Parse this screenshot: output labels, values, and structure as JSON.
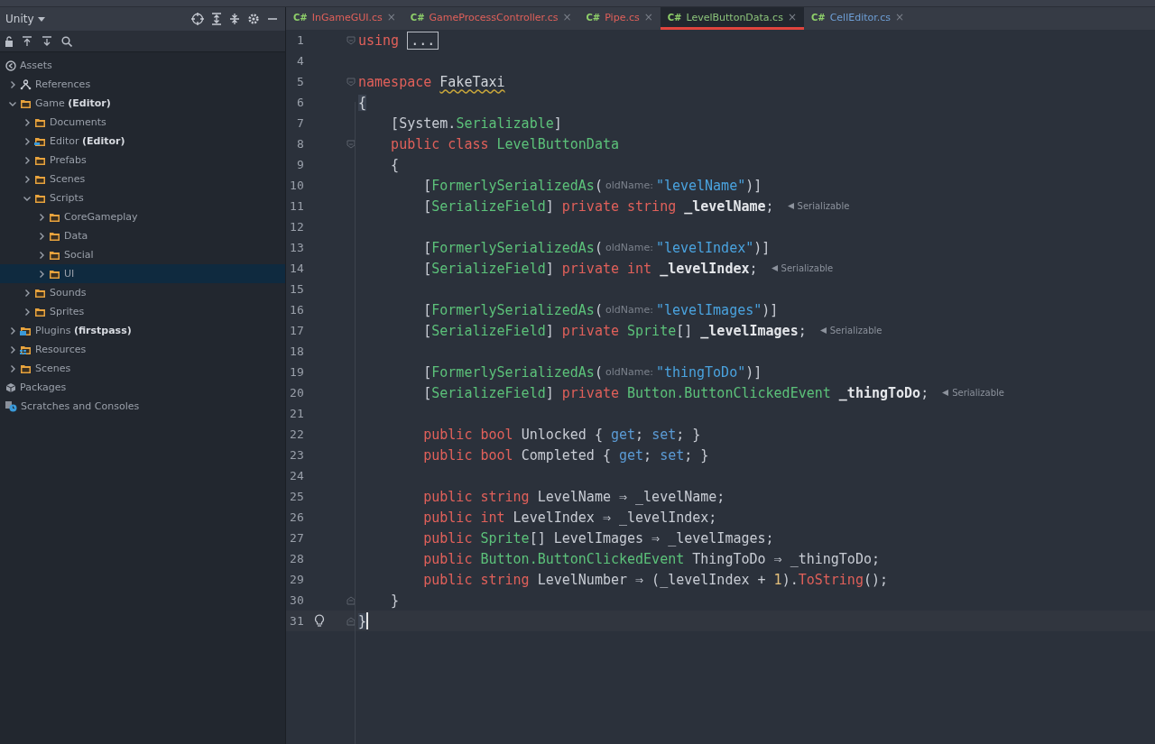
{
  "project": {
    "title": "Unity",
    "tree": [
      {
        "label": "Assets",
        "kind": "assets"
      },
      {
        "label": "References",
        "kind": "references",
        "expanded": false
      },
      {
        "label": "Game **(Editor)**",
        "kind": "folder",
        "expanded": true,
        "selected": false,
        "children": [
          {
            "label": "Documents",
            "kind": "folder",
            "expanded": false,
            "selected": false
          },
          {
            "label": "Editor **(Editor)**",
            "kind": "editor",
            "expanded": false,
            "selected": false
          },
          {
            "label": "Prefabs",
            "kind": "folder",
            "expanded": false,
            "selected": false
          },
          {
            "label": "Scenes",
            "kind": "folder",
            "expanded": false,
            "selected": false
          },
          {
            "label": "Scripts",
            "kind": "folder",
            "expanded": true,
            "selected": false,
            "children": [
              {
                "label": "CoreGameplay",
                "kind": "folder",
                "expanded": false,
                "selected": false
              },
              {
                "label": "Data",
                "kind": "folder",
                "expanded": false,
                "selected": false
              },
              {
                "label": "Social",
                "kind": "folder",
                "expanded": false,
                "selected": false
              },
              {
                "label": "UI",
                "kind": "folder",
                "expanded": false,
                "selected": true
              }
            ]
          },
          {
            "label": "Sounds",
            "kind": "folder",
            "expanded": false,
            "selected": false
          },
          {
            "label": "Sprites",
            "kind": "folder",
            "expanded": false,
            "selected": false
          }
        ]
      },
      {
        "label": "Plugins **(firstpass)**",
        "kind": "plugins",
        "expanded": false,
        "selected": false
      },
      {
        "label": "Resources",
        "kind": "resources",
        "expanded": false,
        "selected": false
      },
      {
        "label": "Scenes",
        "kind": "folder",
        "expanded": false,
        "selected": false
      },
      {
        "label": "Packages",
        "kind": "packages"
      },
      {
        "label": "Scratches and Consoles",
        "kind": "scratches"
      }
    ]
  },
  "tabs": [
    {
      "badge": "C#",
      "label": "InGameGUI.cs",
      "close": "×",
      "color": "#e0605a",
      "selected": false
    },
    {
      "badge": "C#",
      "label": "GameProcessController.cs",
      "close": "×",
      "color": "#e0605a",
      "selected": false
    },
    {
      "badge": "C#",
      "label": "Pipe.cs",
      "close": "×",
      "color": "#e0605a",
      "selected": false
    },
    {
      "badge": "C#",
      "label": "LevelButtonData.cs",
      "close": "×",
      "color": "#8cc47a",
      "selected": true
    },
    {
      "badge": "C#",
      "label": "CellEditor.cs",
      "close": "×",
      "color": "#6e9fd6",
      "selected": false
    }
  ],
  "code": [
    {
      "n": "1",
      "fold_open": true,
      "tokens": [
        {
          "text": "using ",
          "kind": "kw"
        },
        {
          "text": "...",
          "kind": "folded"
        }
      ]
    },
    {
      "n": "4"
    },
    {
      "n": "5",
      "fold_open": true,
      "tokens": [
        {
          "text": "namespace ",
          "kind": "kw"
        },
        {
          "text": "FakeTaxi",
          "kind": "warn"
        }
      ]
    },
    {
      "n": "6",
      "tokens": [
        {
          "text": "{",
          "kind": "match"
        }
      ]
    },
    {
      "n": "7",
      "tokens": [
        {
          "text": "    [System.",
          "kind": "plain"
        },
        {
          "text": "Serializable",
          "kind": "type"
        },
        {
          "text": "]",
          "kind": "plain"
        }
      ]
    },
    {
      "n": "8",
      "fold_open": true,
      "tokens": [
        {
          "text": "    public class ",
          "kind": "kw"
        },
        {
          "text": "LevelButtonData",
          "kind": "type"
        }
      ]
    },
    {
      "n": "9",
      "tokens": [
        {
          "text": "    {",
          "kind": "plain"
        }
      ]
    },
    {
      "n": "10",
      "tokens": [
        {
          "text": "        [",
          "kind": "plain"
        },
        {
          "text": "FormerlySerializedAs",
          "kind": "type"
        },
        {
          "text": "(",
          "kind": "plain"
        },
        {
          "text": "oldName:",
          "kind": "hint"
        },
        {
          "text": "\"levelName\"",
          "kind": "str"
        },
        {
          "text": ")]",
          "kind": "plain"
        }
      ]
    },
    {
      "n": "11",
      "hint": "Serializable",
      "tokens": [
        {
          "text": "        [",
          "kind": "plain"
        },
        {
          "text": "SerializeField",
          "kind": "type"
        },
        {
          "text": "] ",
          "kind": "plain"
        },
        {
          "text": "private string ",
          "kind": "kw"
        },
        {
          "text": "_levelName",
          "kind": "field"
        },
        {
          "text": ";",
          "kind": "plain"
        }
      ]
    },
    {
      "n": "12"
    },
    {
      "n": "13",
      "tokens": [
        {
          "text": "        [",
          "kind": "plain"
        },
        {
          "text": "FormerlySerializedAs",
          "kind": "type"
        },
        {
          "text": "(",
          "kind": "plain"
        },
        {
          "text": "oldName:",
          "kind": "hint"
        },
        {
          "text": "\"levelIndex\"",
          "kind": "str"
        },
        {
          "text": ")]",
          "kind": "plain"
        }
      ]
    },
    {
      "n": "14",
      "hint": "Serializable",
      "tokens": [
        {
          "text": "        [",
          "kind": "plain"
        },
        {
          "text": "SerializeField",
          "kind": "type"
        },
        {
          "text": "] ",
          "kind": "plain"
        },
        {
          "text": "private int ",
          "kind": "kw"
        },
        {
          "text": "_levelIndex",
          "kind": "field"
        },
        {
          "text": ";",
          "kind": "plain"
        }
      ]
    },
    {
      "n": "15"
    },
    {
      "n": "16",
      "tokens": [
        {
          "text": "        [",
          "kind": "plain"
        },
        {
          "text": "FormerlySerializedAs",
          "kind": "type"
        },
        {
          "text": "(",
          "kind": "plain"
        },
        {
          "text": "oldName:",
          "kind": "hint"
        },
        {
          "text": "\"levelImages\"",
          "kind": "str"
        },
        {
          "text": ")]",
          "kind": "plain"
        }
      ]
    },
    {
      "n": "17",
      "hint": "Serializable",
      "tokens": [
        {
          "text": "        [",
          "kind": "plain"
        },
        {
          "text": "SerializeField",
          "kind": "type"
        },
        {
          "text": "] ",
          "kind": "plain"
        },
        {
          "text": "private ",
          "kind": "kw"
        },
        {
          "text": "Sprite",
          "kind": "type"
        },
        {
          "text": "[] ",
          "kind": "plain"
        },
        {
          "text": "_levelImages",
          "kind": "field"
        },
        {
          "text": ";",
          "kind": "plain"
        }
      ]
    },
    {
      "n": "18"
    },
    {
      "n": "19",
      "tokens": [
        {
          "text": "        [",
          "kind": "plain"
        },
        {
          "text": "FormerlySerializedAs",
          "kind": "type"
        },
        {
          "text": "(",
          "kind": "plain"
        },
        {
          "text": "oldName:",
          "kind": "hint"
        },
        {
          "text": "\"thingToDo\"",
          "kind": "str"
        },
        {
          "text": ")]",
          "kind": "plain"
        }
      ]
    },
    {
      "n": "20",
      "hint": "Serializable",
      "tokens": [
        {
          "text": "        [",
          "kind": "plain"
        },
        {
          "text": "SerializeField",
          "kind": "type"
        },
        {
          "text": "] ",
          "kind": "plain"
        },
        {
          "text": "private ",
          "kind": "kw"
        },
        {
          "text": "Button.ButtonClickedEvent",
          "kind": "type"
        },
        {
          "text": " _thingToDo",
          "kind": "field"
        },
        {
          "text": ";",
          "kind": "plain"
        }
      ]
    },
    {
      "n": "21"
    },
    {
      "n": "22",
      "tokens": [
        {
          "text": "        public bool ",
          "kind": "kw"
        },
        {
          "text": "Unlocked { ",
          "kind": "plain"
        },
        {
          "text": "get",
          "kind": "prop"
        },
        {
          "text": "; ",
          "kind": "plain"
        },
        {
          "text": "set",
          "kind": "prop"
        },
        {
          "text": "; }",
          "kind": "plain"
        }
      ]
    },
    {
      "n": "23",
      "tokens": [
        {
          "text": "        public bool ",
          "kind": "kw"
        },
        {
          "text": "Completed { ",
          "kind": "plain"
        },
        {
          "text": "get",
          "kind": "prop"
        },
        {
          "text": "; ",
          "kind": "plain"
        },
        {
          "text": "set",
          "kind": "prop"
        },
        {
          "text": "; }",
          "kind": "plain"
        }
      ]
    },
    {
      "n": "24"
    },
    {
      "n": "25",
      "tokens": [
        {
          "text": "        public string ",
          "kind": "kw"
        },
        {
          "text": "LevelName ⇒ _levelName;",
          "kind": "plain"
        }
      ]
    },
    {
      "n": "26",
      "tokens": [
        {
          "text": "        public int ",
          "kind": "kw"
        },
        {
          "text": "LevelIndex ⇒ _levelIndex;",
          "kind": "plain"
        }
      ]
    },
    {
      "n": "27",
      "tokens": [
        {
          "text": "        public ",
          "kind": "kw"
        },
        {
          "text": "Sprite",
          "kind": "type"
        },
        {
          "text": "[] LevelImages ⇒ _levelImages;",
          "kind": "plain"
        }
      ]
    },
    {
      "n": "28",
      "tokens": [
        {
          "text": "        public ",
          "kind": "kw"
        },
        {
          "text": "Button.ButtonClickedEvent",
          "kind": "type"
        },
        {
          "text": " ThingToDo ⇒ _thingToDo;",
          "kind": "plain"
        }
      ]
    },
    {
      "n": "29",
      "tokens": [
        {
          "text": "        public string ",
          "kind": "kw"
        },
        {
          "text": "LevelNumber ⇒ (_levelIndex + ",
          "kind": "plain"
        },
        {
          "text": "1",
          "kind": "num"
        },
        {
          "text": ").",
          "kind": "plain"
        },
        {
          "text": "ToString",
          "kind": "method"
        },
        {
          "text": "();",
          "kind": "plain"
        }
      ]
    },
    {
      "n": "30",
      "fold_close": true,
      "tokens": [
        {
          "text": "    }",
          "kind": "plain"
        }
      ]
    },
    {
      "n": "31",
      "fold_close": true,
      "current": true,
      "tokens": [
        {
          "text": "}",
          "kind": "match"
        }
      ]
    }
  ]
}
